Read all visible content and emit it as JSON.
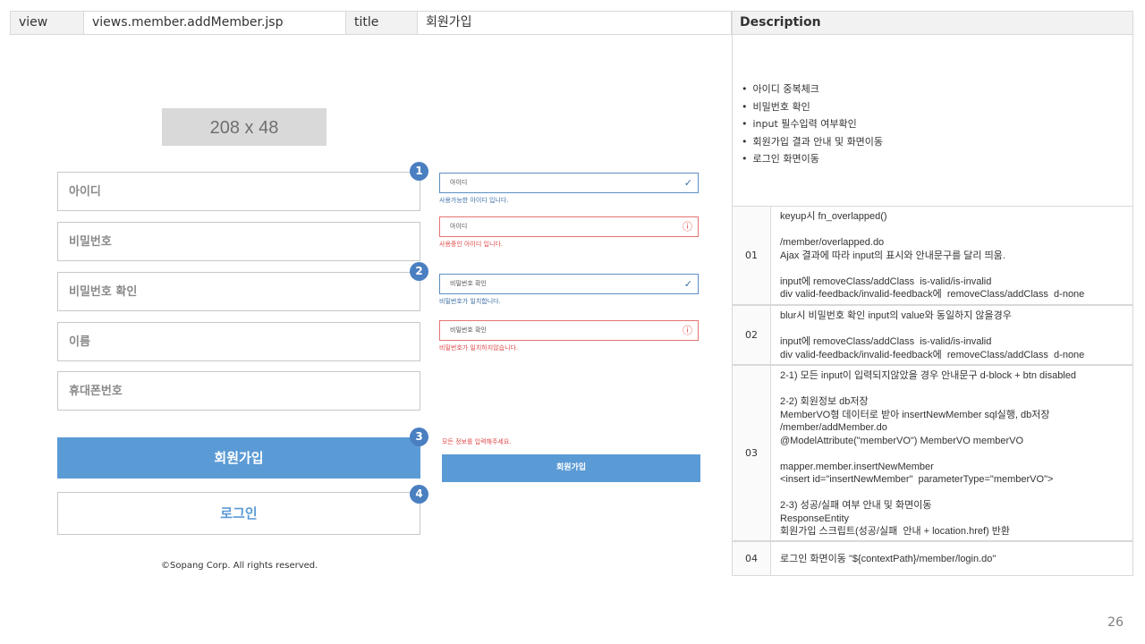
{
  "header": {
    "view_label": "view",
    "view_value": "views.member.addMember.jsp",
    "title_label": "title",
    "title_value": "회원가입",
    "description_label": "Description"
  },
  "form": {
    "logo_placeholder": "208 x 48",
    "fields": [
      "아이디",
      "비밀번호",
      "비밀번호 확인",
      "이름",
      "휴대폰번호"
    ],
    "join_button": "회원가입",
    "login_button": "로그인",
    "copyright": "©Sopang Corp. All rights reserved."
  },
  "badges": [
    "1",
    "2",
    "3",
    "4"
  ],
  "validation": {
    "id_valid_value": "아이디",
    "id_valid_msg": "사용가능한 아이디 입니다.",
    "id_invalid_value": "아이디",
    "id_invalid_msg": "사용중인 아이디 입니다.",
    "pw_valid_value": "비밀번호 확인",
    "pw_valid_msg": "비밀번호가 일치합니다.",
    "pw_invalid_value": "비밀번호 확인",
    "pw_invalid_msg": "비밀번호가 일치하지않습니다.",
    "all_required_msg": "모든 정보를 입력해주세요.",
    "join_button_small": "회원가입",
    "valid_icon": "check-icon",
    "invalid_icon": "error-circle-icon"
  },
  "description": {
    "bullets": [
      "아이디 중복체크",
      "비밀번호 확인",
      "input 필수입력 여부확인",
      "회원가입 결과 안내 및 화면이동",
      "로그인 화면이동"
    ],
    "rows": [
      {
        "num": "01",
        "text": "keyup시 fn_overlapped()\n\n/member/overlapped.do\nAjax 결과에 따라 input의 표시와 안내문구를 달리 띄움.\n\ninput에 removeClass/addClass  is-valid/is-invalid\ndiv valid-feedback/invalid-feedback에  removeClass/addClass  d-none"
      },
      {
        "num": "02",
        "text": "blur시 비밀번호 확인 input의 value와 동일하지 않을경우\n\ninput에 removeClass/addClass  is-valid/is-invalid\ndiv valid-feedback/invalid-feedback에  removeClass/addClass  d-none"
      },
      {
        "num": "03",
        "text": "2-1) 모든 input이 입력되지않았을 경우 안내문구 d-block + btn disabled\n\n2-2) 회원정보 db저장\nMemberVO형 데이터로 받아 insertNewMember sql실행, db저장\n/member/addMember.do\n@ModelAttribute(\"memberVO\") MemberVO memberVO\n\nmapper.member.insertNewMember\n<insert id=\"insertNewMember\"  parameterType=\"memberVO\">\n\n2-3) 성공/실패 여부 안내 및 화면이동\nResponseEntity\n회원가입 스크립트(성공/실패  안내 + location.href) 반환"
      },
      {
        "num": "04",
        "text": "로그인 화면이동 \"${contextPath}/member/login.do\""
      }
    ]
  },
  "page_number": "26",
  "colors": {
    "accent": "#5b9bd5",
    "badge": "#4a7fc1",
    "valid": "#3d6fa5",
    "invalid": "#e04848"
  }
}
